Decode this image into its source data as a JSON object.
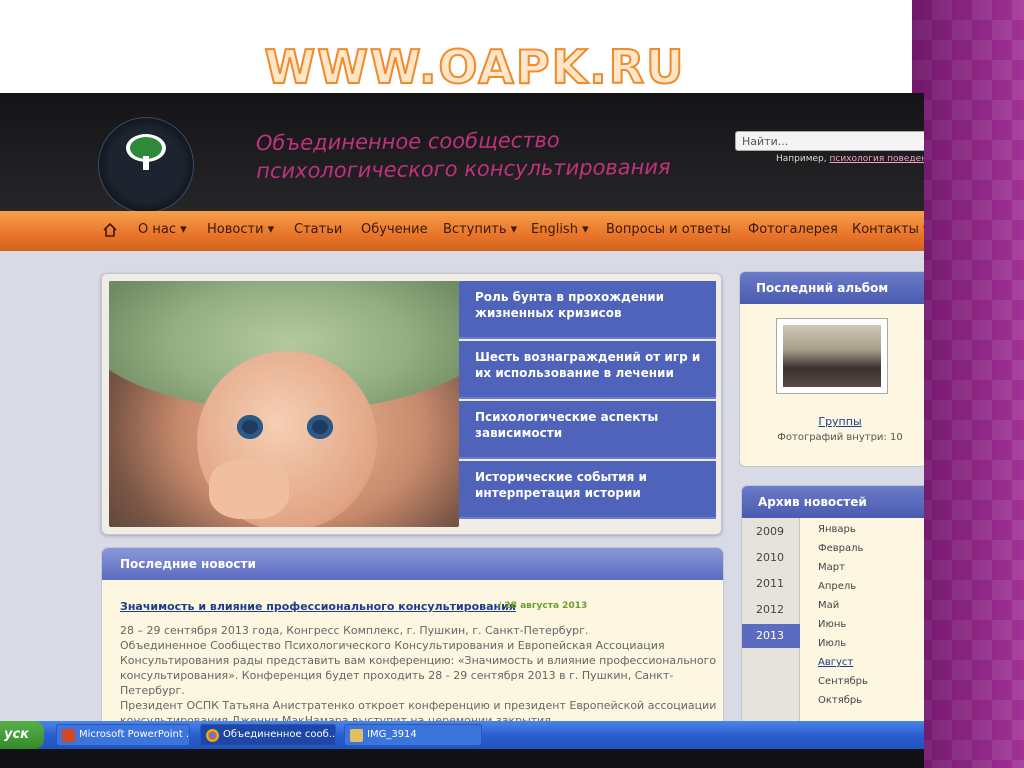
{
  "slide": {
    "title": "WWW.OAPK.RU"
  },
  "site": {
    "title_line1": "Объединенное сообщество",
    "title_line2": "психологического консультирования",
    "search_placeholder": "Найти...",
    "search_example_prefix": "Например, ",
    "search_example_link": "психология поведения"
  },
  "menu": [
    {
      "label": "О нас ▾"
    },
    {
      "label": "Новости ▾"
    },
    {
      "label": "Статьи"
    },
    {
      "label": "Обучение"
    },
    {
      "label": "Вступить ▾"
    },
    {
      "label": "English ▾"
    },
    {
      "label": "Вопросы и ответы"
    },
    {
      "label": "Фотогалерея"
    },
    {
      "label": "Контакты ▾"
    }
  ],
  "slider": [
    {
      "title": "Роль бунта в прохождении жизненных кризисов"
    },
    {
      "title": "Шесть вознаграждений от игр и их использование в лечении"
    },
    {
      "title": "Психологические аспекты зависимости"
    },
    {
      "title": "Исторические события и интерпретация истории"
    }
  ],
  "news": {
    "heading": "Последние новости",
    "item_title": "Значимость и влияние профессионального консультирования",
    "item_date": "/ 28 августа 2013",
    "body": [
      "28 – 29 сентября 2013 года, Конгресс Комплекс, г. Пушкин, г. Санкт-Петербург.",
      "Объединенное Сообщество Психологического Консультирования и Европейская Ассоциация",
      "Консультирования  рады представить вам конференцию: «Значимость и влияние профессионального",
      "консультирования». Конференция будет проходить  28 - 29 сентября 2013        в г. Пушкин, Санкт-",
      "Петербург.",
      "Президент ОСПК  Татьяна Анистратенко откроет конференцию и президент Европейской ассоциации",
      "консультирования Дженни МакНамара  выступит  на церемонии закрытия."
    ]
  },
  "album": {
    "heading": "Последний альбом",
    "link": "Группы",
    "count": "Фотографий внутри: 10"
  },
  "archive": {
    "heading": "Архив новостей",
    "years": [
      "2009",
      "2010",
      "2011",
      "2012",
      "2013"
    ],
    "active_year": "2013",
    "months": [
      "Январь",
      "Февраль",
      "Март",
      "Апрель",
      "Май",
      "Июнь",
      "Июль",
      "Август",
      "Сентябрь",
      "Октябрь"
    ],
    "active_month": "Август"
  },
  "taskbar": {
    "start": "уск",
    "tasks": [
      "Microsoft PowerPoint ...",
      "Объединенное сооб...",
      "IMG_3914"
    ]
  },
  "colors": {
    "accent_orange": "#e8752a",
    "header_blue": "#5b6cc0",
    "title_pink": "#c0327c"
  }
}
